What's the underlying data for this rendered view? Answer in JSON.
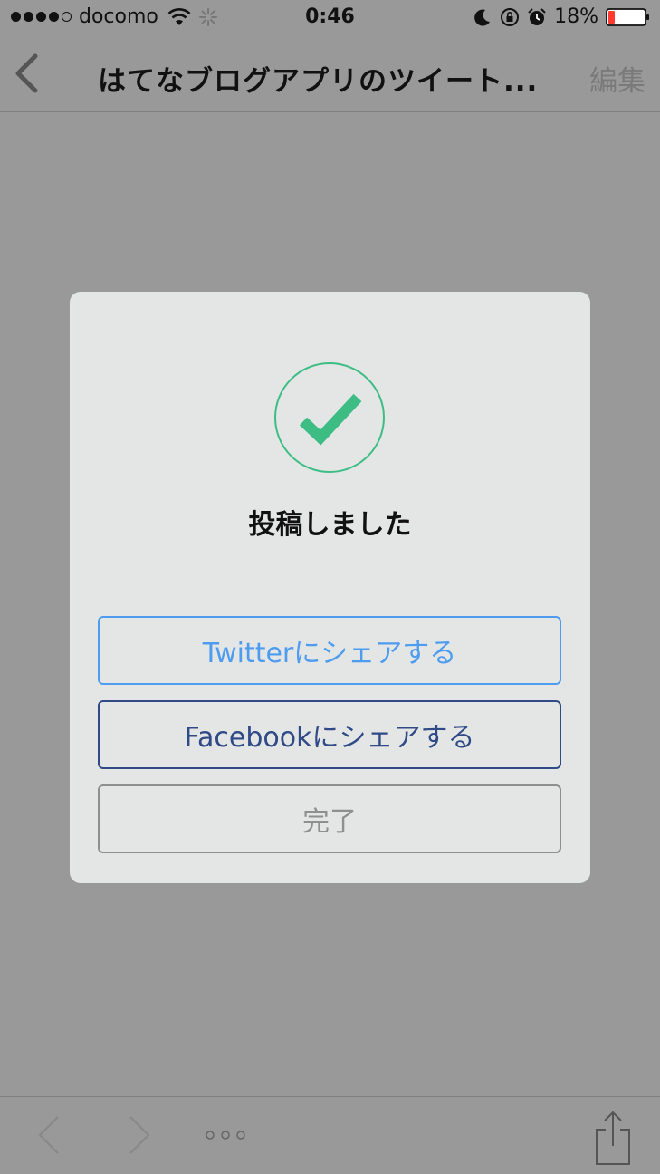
{
  "status_bar": {
    "carrier": "docomo",
    "time": "0:46",
    "battery_percent": "18%",
    "signal_bars": 4,
    "signal_max": 5,
    "battery_level": 0.18,
    "icons": [
      "wifi-icon",
      "loading-spinner-icon",
      "moon-icon",
      "rotation-lock-icon",
      "alarm-icon",
      "battery-icon"
    ]
  },
  "nav": {
    "title": "はてなブログアプリのツイート...",
    "edit_label": "編集",
    "back_icon": "chevron-left-icon"
  },
  "modal": {
    "icon": "checkmark-circle-icon",
    "message": "投稿しました",
    "twitter_button": "Twitterにシェアする",
    "facebook_button": "Facebookにシェアする",
    "done_button": "完了"
  },
  "toolbar": {
    "icons": [
      "back-arrow-icon",
      "forward-arrow-icon",
      "more-dots-icon",
      "share-icon"
    ]
  },
  "colors": {
    "overlay_background": "#999999",
    "modal_background": "#e4e6e6",
    "check_green": "#3dbd84",
    "twitter_blue": "#4e9cf0",
    "facebook_blue": "#2f4a86",
    "done_gray": "#8f8f8f",
    "battery_red": "#ff3b30"
  }
}
